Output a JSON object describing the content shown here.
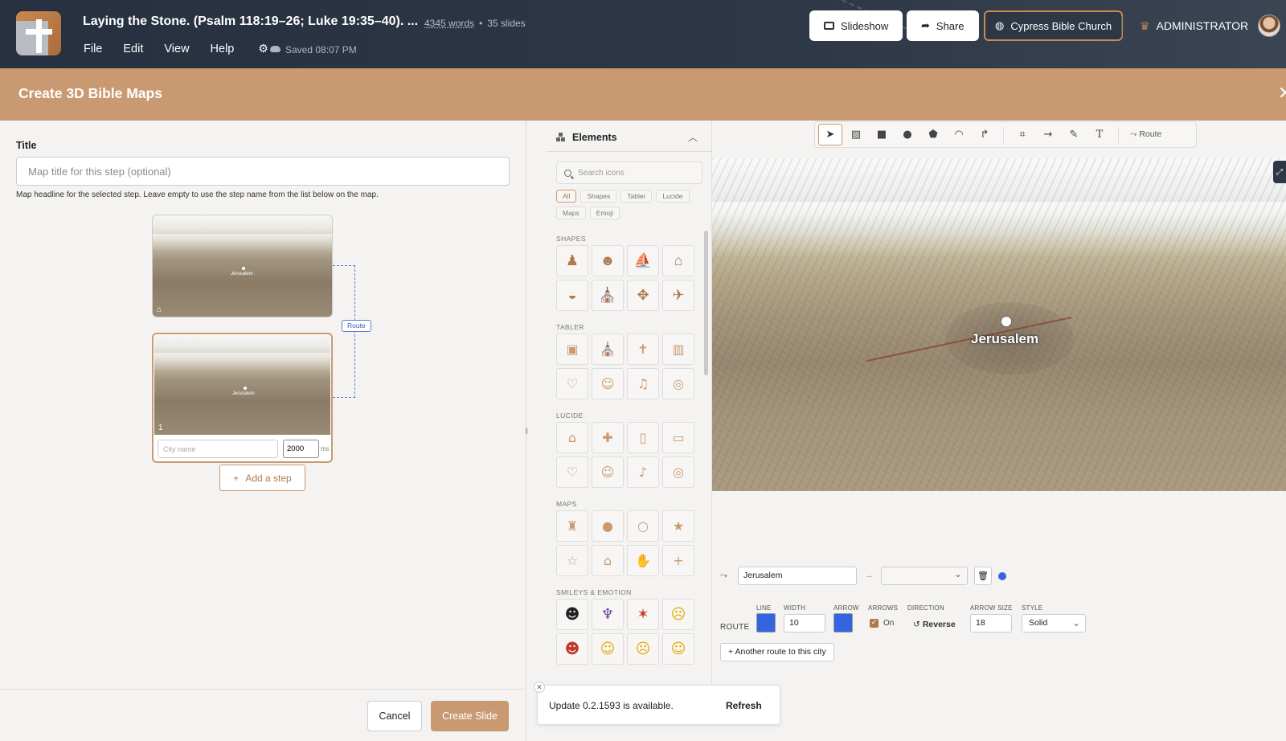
{
  "app": {
    "doc_title": "Laying the Stone. (Psalm 118:19–26; Luke 19:35–40). ...",
    "word_count": "4345 words",
    "slide_count": "35 slides",
    "menu": [
      "File",
      "Edit",
      "View",
      "Help"
    ],
    "saved_status": "Saved 08:07 PM",
    "buttons": {
      "slideshow": "Slideshow",
      "share": "Share",
      "church": "Cypress Bible Church"
    },
    "user_role": "ADMINISTRATOR"
  },
  "modal": {
    "title": "Create 3D Bible Maps",
    "title_field_label": "Title",
    "title_field_placeholder": "Map title for this step (optional)",
    "title_field_help": "Map headline for the selected step. Leave empty to use the step name from the list below on the map.",
    "route_chip": "Route",
    "step": {
      "number": "1",
      "city_placeholder": "City name",
      "duration": "2000",
      "duration_unit": "ms",
      "map_label": "Jerusalem"
    },
    "add_step": "Add a step",
    "cancel": "Cancel",
    "create": "Create Slide"
  },
  "elements_panel": {
    "title": "Elements",
    "search_placeholder": "Search icons",
    "filters": [
      "All",
      "Shapes",
      "Tabler",
      "Lucide",
      "Maps",
      "Emoji"
    ],
    "active_filter": "All",
    "sections": {
      "shapes": {
        "label": "SHAPES",
        "icons": [
          "person-icon",
          "monkey-icon",
          "boat-icon",
          "house-icon",
          "cat-icon",
          "church-icon",
          "cross-grid-icon",
          "dove-icon"
        ]
      },
      "tabler": {
        "label": "TABLER",
        "icons": [
          "bible-icon",
          "church-icon",
          "cross-icon",
          "book-icon",
          "heart-icon",
          "users-icon",
          "music-icon",
          "map-pin-icon"
        ]
      },
      "lucide": {
        "label": "LUCIDE",
        "icons": [
          "church-icon",
          "cross-icon",
          "book-open-icon",
          "book-icon",
          "heart-icon",
          "users-icon",
          "music-icon",
          "map-pin-icon"
        ]
      },
      "maps": {
        "label": "MAPS",
        "icons": [
          "city-icon",
          "pin-icon",
          "pin-outline-icon",
          "star-icon",
          "star-outline-icon",
          "building-icon",
          "thumbs-up-icon",
          "plus-icon"
        ]
      },
      "smileys": {
        "label": "SMILEYS & EMOTION",
        "icons": [
          "alien-icon",
          "alien-monster-icon",
          "anger-icon",
          "confused-face-icon",
          "devil-icon",
          "anxious-face-icon",
          "worried-face-icon",
          "hushed-face-icon"
        ]
      }
    }
  },
  "map": {
    "toolbar_route": "Route",
    "city_label": "Jerusalem",
    "route_editor": {
      "origin": "Jerusalem",
      "labels": {
        "route": "ROUTE",
        "line": "LINE",
        "width": "WIDTH",
        "arrow": "ARROW",
        "arrows": "ARROWS",
        "direction": "DIRECTION",
        "arrow_size": "ARROW SIZE",
        "style": "STYLE"
      },
      "width": "10",
      "arrows_toggle": "On",
      "reverse": "Reverse",
      "arrow_size": "18",
      "style": "Solid",
      "another_route": "Another route to this city",
      "line_color": "#3464e0",
      "arrow_color": "#3464e0"
    }
  },
  "toast": {
    "message": "Update 0.2.1593 is available.",
    "action": "Refresh"
  }
}
